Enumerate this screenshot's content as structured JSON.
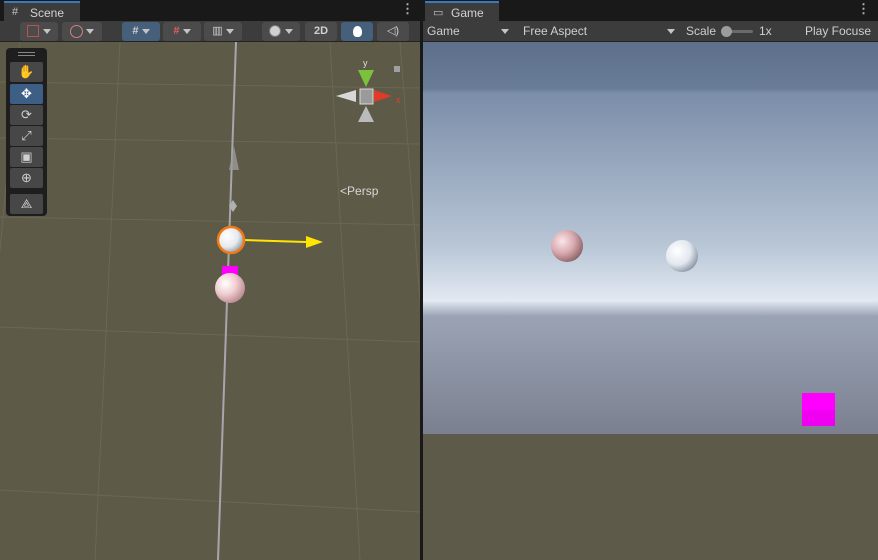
{
  "scene_tab": {
    "label": "Scene",
    "icon": "grid-icon"
  },
  "game_tab": {
    "label": "Game",
    "icon": "gamepad-icon"
  },
  "scene_toolbar": {
    "draw_mode_icon": "shaded-icon",
    "orientation_icon": "globe-icon",
    "snap_icon": "snap-grid-icon",
    "grid_icon": "grid-toggle-icon",
    "increment_icon": "increment-snap-icon",
    "render_icon": "render-sphere-icon",
    "mode_2d_label": "2D",
    "lighting_icon": "lightbulb-icon",
    "audio_icon": "audio-icon"
  },
  "tools": [
    {
      "name": "hand-tool",
      "icon": "✋"
    },
    {
      "name": "move-tool",
      "icon": "✥"
    },
    {
      "name": "rotate-tool",
      "icon": "⟳"
    },
    {
      "name": "scale-tool",
      "icon": "⤢"
    },
    {
      "name": "rect-tool",
      "icon": "▣"
    },
    {
      "name": "transform-tool",
      "icon": "⊕"
    },
    {
      "name": "custom-tool",
      "icon": "⟁"
    }
  ],
  "gizmo": {
    "y_label": "y",
    "x_label": "x",
    "projection_label": "Persp"
  },
  "game_toolbar": {
    "display_label": "Game",
    "aspect_label": "Free Aspect",
    "scale_label": "Scale",
    "scale_value": "1x",
    "scale_fraction": 0.0,
    "play_label": "Play Focuse"
  },
  "colors": {
    "accent": "#3a79bb",
    "scene_bg": "#5e5a48",
    "handle_y": "#ffe500",
    "selection": "#f07a16",
    "cube": "#ff00ff",
    "sphere_pink": "#e6b3b8",
    "sphere_white": "#e8eef5"
  }
}
